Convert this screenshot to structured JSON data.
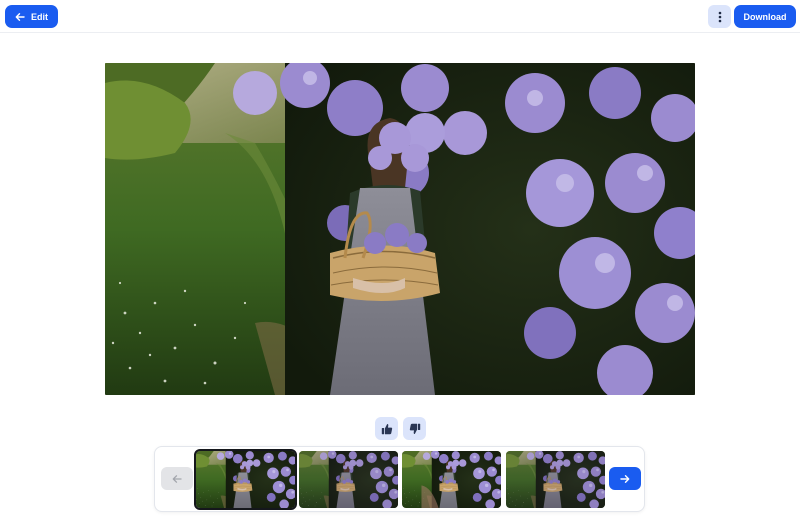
{
  "toolbar": {
    "edit_label": "Edit",
    "download_label": "Download",
    "back_icon": "arrow-left-icon",
    "more_icon": "more-vertical-icon",
    "accent_color": "#1a5cf0"
  },
  "image": {
    "subject": "lilac-garden-photo"
  },
  "feedback": {
    "like_icon": "thumbs-up-icon",
    "dislike_icon": "thumbs-down-icon"
  },
  "carousel": {
    "prev_icon": "arrow-left-icon",
    "next_icon": "arrow-right-icon",
    "selected_index": 0,
    "thumbnail_count": 4
  }
}
